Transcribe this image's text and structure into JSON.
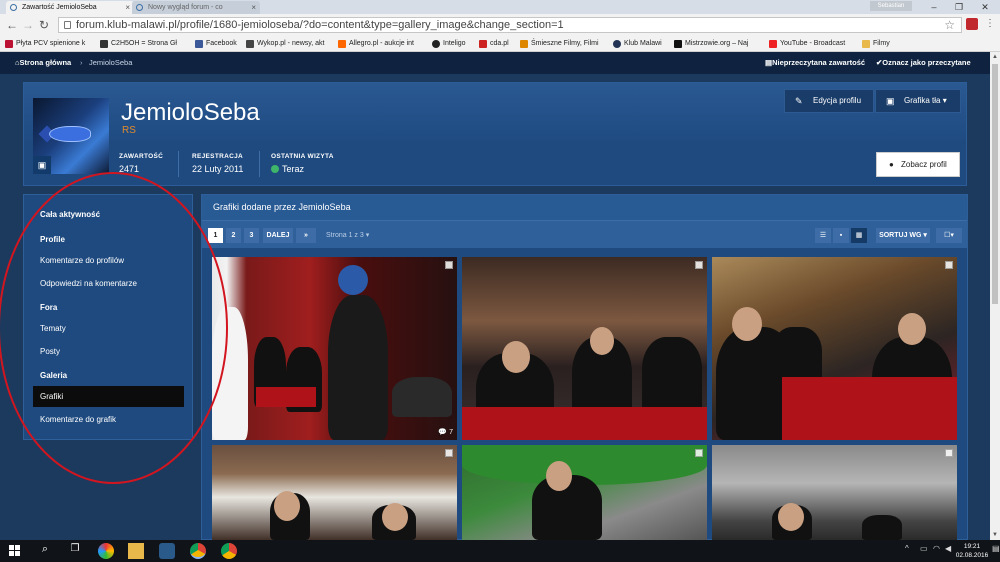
{
  "browser": {
    "tabs": [
      {
        "label": "Zawartość JemioloSeba",
        "active": true
      },
      {
        "label": "Nowy wygląd forum - co",
        "active": false
      }
    ],
    "user_badge": "Sebastian",
    "url": "forum.klub-malawi.pl/profile/1680-jemioloseba/?do=content&type=gallery_image&change_section=1"
  },
  "bookmarks": [
    {
      "label": "Płyta PCV spienione k",
      "color": "#b13"
    },
    {
      "label": "C2H5OH = Strona Gł",
      "color": "#333"
    },
    {
      "label": "Facebook",
      "color": "#3b5998"
    },
    {
      "label": "Wykop.pl - newsy, akt",
      "color": "#444"
    },
    {
      "label": "Allegro.pl - aukcje int",
      "color": "#f60"
    },
    {
      "label": "Inteligo",
      "color": "#222"
    },
    {
      "label": "cda.pl",
      "color": "#c22"
    },
    {
      "label": "Śmieszne Filmy, Filmi",
      "color": "#d80"
    },
    {
      "label": "Klub Malawi",
      "color": "#235"
    },
    {
      "label": "Mistrzowie.org – Naj",
      "color": "#111"
    },
    {
      "label": "YouTube - Broadcast",
      "color": "#e22"
    },
    {
      "label": "Filmy",
      "color": "#e8b84a"
    }
  ],
  "site_nav": {
    "home": "Strona główna",
    "crumb": "JemioloSeba",
    "unread": "Nieprzeczytana zawartość",
    "mark_read": "Oznacz jako przeczytane"
  },
  "profile": {
    "name": "JemioloSeba",
    "rank": "RS",
    "stats": [
      {
        "key": "ZAWARTOŚĆ",
        "value": "2471"
      },
      {
        "key": "REJESTRACJA",
        "value": "22 Luty 2011"
      },
      {
        "key": "OSTATNIA WIZYTA",
        "value": "Teraz"
      }
    ],
    "edit_button": "Edycja profilu",
    "cover_button": "Grafika tła",
    "view_button": "Zobacz profil"
  },
  "sidebar": {
    "items": [
      {
        "label": "Cała aktywność",
        "bold": true,
        "active": false
      },
      {
        "label": "Profile",
        "bold": true,
        "active": false
      },
      {
        "label": "Komentarze do profilów",
        "bold": false,
        "active": false
      },
      {
        "label": "Odpowiedzi na komentarze",
        "bold": false,
        "active": false
      },
      {
        "label": "Fora",
        "bold": true,
        "active": false
      },
      {
        "label": "Tematy",
        "bold": false,
        "active": false
      },
      {
        "label": "Posty",
        "bold": false,
        "active": false
      },
      {
        "label": "Galeria",
        "bold": true,
        "active": false
      },
      {
        "label": "Grafiki",
        "bold": false,
        "active": true
      },
      {
        "label": "Komentarze do grafik",
        "bold": false,
        "active": false
      }
    ]
  },
  "gallery": {
    "title": "Grafiki dodane przez JemioloSeba",
    "pages": [
      "1",
      "2",
      "3"
    ],
    "next": "DALEJ",
    "last": "»",
    "page_info": "Strona 1 z 3 ▾",
    "sort": "SORTUJ WG ▾",
    "images": [
      {
        "comments": "7"
      },
      {
        "comments": ""
      },
      {
        "comments": ""
      },
      {
        "comments": ""
      },
      {
        "comments": ""
      },
      {
        "comments": ""
      }
    ]
  },
  "taskbar": {
    "time": "19:21",
    "date": "02.08.2016"
  }
}
